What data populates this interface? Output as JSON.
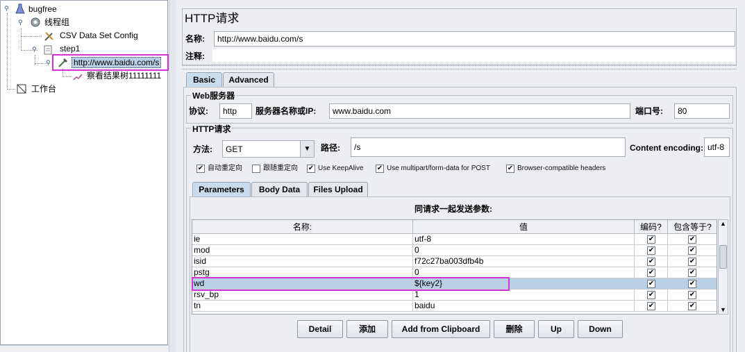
{
  "tree": {
    "root": "bugfree",
    "thread_group": "线程组",
    "csv_config": "CSV Data Set Config",
    "step": "step1",
    "http_sampler": "http://www.baidu.com/s",
    "result_tree": "察看结果树11111111",
    "workbench": "工作台"
  },
  "panel": {
    "title": "HTTP请求",
    "name_label": "名称:",
    "name_value": "http://www.baidu.com/s",
    "comment_label": "注释:",
    "tabs": [
      "Basic",
      "Advanced"
    ]
  },
  "web_server": {
    "section": "Web服务器",
    "protocol_label": "协议:",
    "protocol_value": "http",
    "server_label": "服务器名称或IP:",
    "server_value": "www.baidu.com",
    "port_label": "端口号:",
    "port_value": "80"
  },
  "http_request": {
    "section": "HTTP请求",
    "method_label": "方法:",
    "method_value": "GET",
    "path_label": "路径:",
    "path_value": "/s",
    "encoding_label": "Content encoding:",
    "encoding_value": "utf-8",
    "options": [
      {
        "label": "自动重定向",
        "checked": true
      },
      {
        "label": "跟随重定向",
        "checked": false
      },
      {
        "label": "Use KeepAlive",
        "checked": true
      },
      {
        "label": "Use multipart/form-data for POST",
        "checked": true
      },
      {
        "label": "Browser-compatible headers",
        "checked": true
      }
    ]
  },
  "params": {
    "tabs": [
      "Parameters",
      "Body Data",
      "Files Upload"
    ],
    "caption": "同请求一起发送参数:",
    "columns": [
      "名称:",
      "值",
      "编码?",
      "包含等于?"
    ],
    "rows": [
      {
        "name": "ie",
        "value": "utf-8",
        "encode": true,
        "include_equals": true
      },
      {
        "name": "mod",
        "value": "0",
        "encode": true,
        "include_equals": true
      },
      {
        "name": "isid",
        "value": "f72c27ba003dfb4b",
        "encode": true,
        "include_equals": true
      },
      {
        "name": "pstg",
        "value": "0",
        "encode": true,
        "include_equals": true
      },
      {
        "name": "wd",
        "value": "${key2}",
        "encode": true,
        "include_equals": true
      },
      {
        "name": "rsv_bp",
        "value": "1",
        "encode": true,
        "include_equals": true
      },
      {
        "name": "tn",
        "value": "baidu",
        "encode": true,
        "include_equals": true
      }
    ],
    "selected_row": 4,
    "buttons": [
      "Detail",
      "添加",
      "Add from Clipboard",
      "删除",
      "Up",
      "Down"
    ]
  },
  "colors": {
    "highlight": "#d432d8",
    "selection": "#b8cfe5",
    "active_tab": "#c8dcee"
  }
}
